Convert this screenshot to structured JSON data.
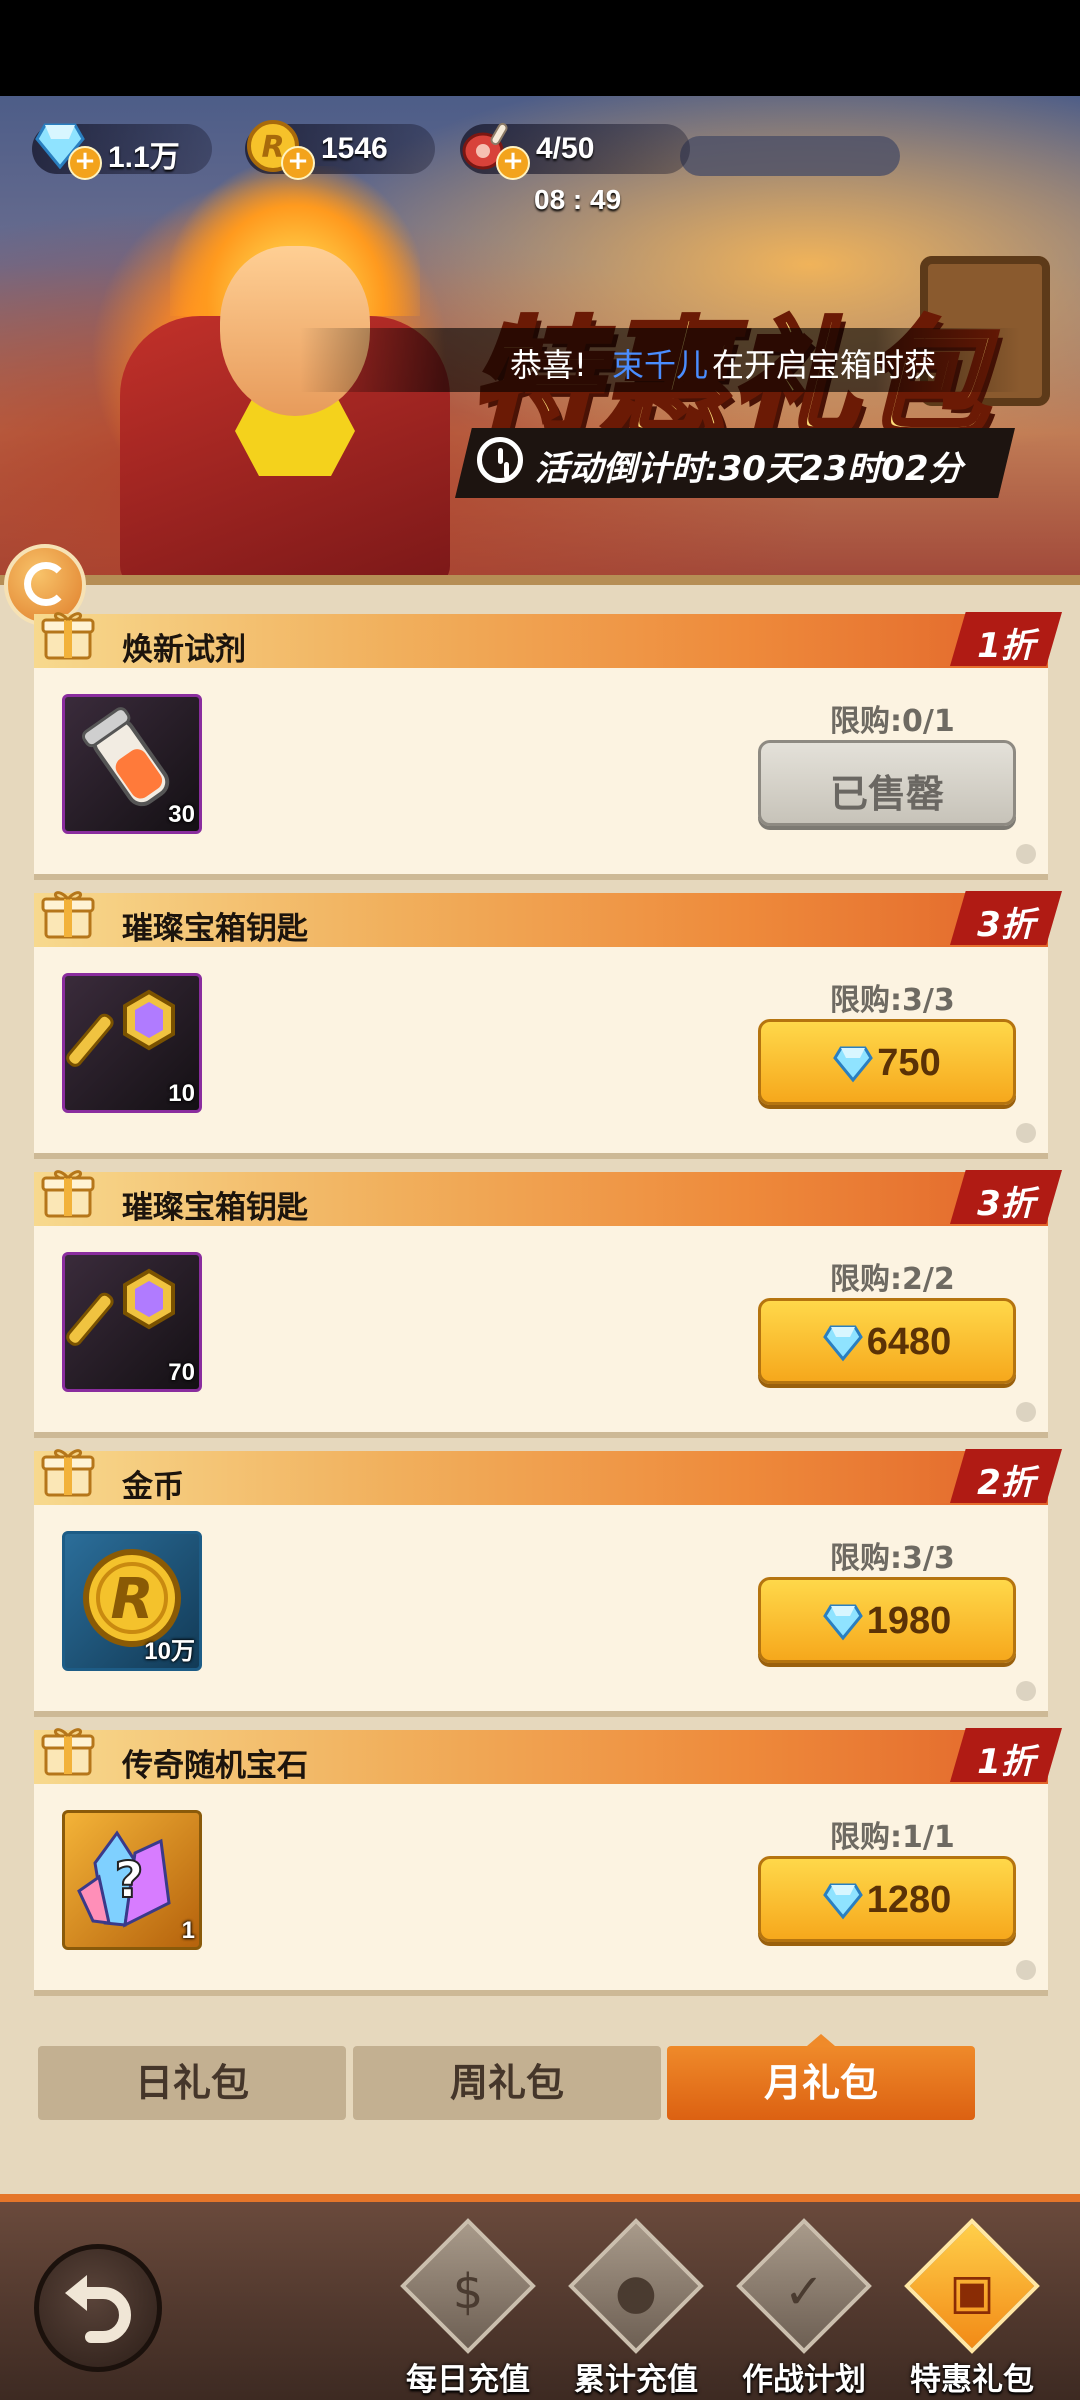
{
  "resources": {
    "gems": "1.1万",
    "coins": "1546",
    "stamina": "4/50",
    "stamina_timer": "08 : 49"
  },
  "banner": {
    "title": "特惠礼包",
    "marquee_prefix": "恭喜!",
    "marquee_name": "束千儿",
    "marquee_suffix": "在开启宝箱时获",
    "countdown": "活动倒计时:30天23时02分"
  },
  "packs": [
    {
      "name": "焕新试剂",
      "discount": "1折",
      "limit": "限购:0/1",
      "price": "已售罄",
      "sold_out": true,
      "qty": "30",
      "icon": "potion-icon"
    },
    {
      "name": "璀璨宝箱钥匙",
      "discount": "3折",
      "limit": "限购:3/3",
      "price": "750",
      "sold_out": false,
      "qty": "10",
      "icon": "key-icon"
    },
    {
      "name": "璀璨宝箱钥匙",
      "discount": "3折",
      "limit": "限购:2/2",
      "price": "6480",
      "sold_out": false,
      "qty": "70",
      "icon": "key-icon"
    },
    {
      "name": "金币",
      "discount": "2折",
      "limit": "限购:3/3",
      "price": "1980",
      "sold_out": false,
      "qty": "10万",
      "icon": "coin-icon"
    },
    {
      "name": "传奇随机宝石",
      "discount": "1折",
      "limit": "限购:1/1",
      "price": "1280",
      "sold_out": false,
      "qty": "1",
      "icon": "gem-crystal-icon"
    }
  ],
  "tabs": [
    {
      "label": "日礼包",
      "active": false
    },
    {
      "label": "周礼包",
      "active": false
    },
    {
      "label": "月礼包",
      "active": true
    }
  ],
  "nav": [
    {
      "label": "每日充值",
      "icon": "dollar-icon",
      "active": false
    },
    {
      "label": "累计充值",
      "icon": "piggy-bank-icon",
      "active": false
    },
    {
      "label": "作战计划",
      "icon": "calendar-check-icon",
      "active": false
    },
    {
      "label": "特惠礼包",
      "icon": "gift-icon",
      "active": true
    }
  ],
  "colors": {
    "accent_orange": "#e5762a",
    "discount_red": "#b01b14",
    "buy_button": "#f6a81c",
    "panel_bg": "#e6d8bd"
  }
}
